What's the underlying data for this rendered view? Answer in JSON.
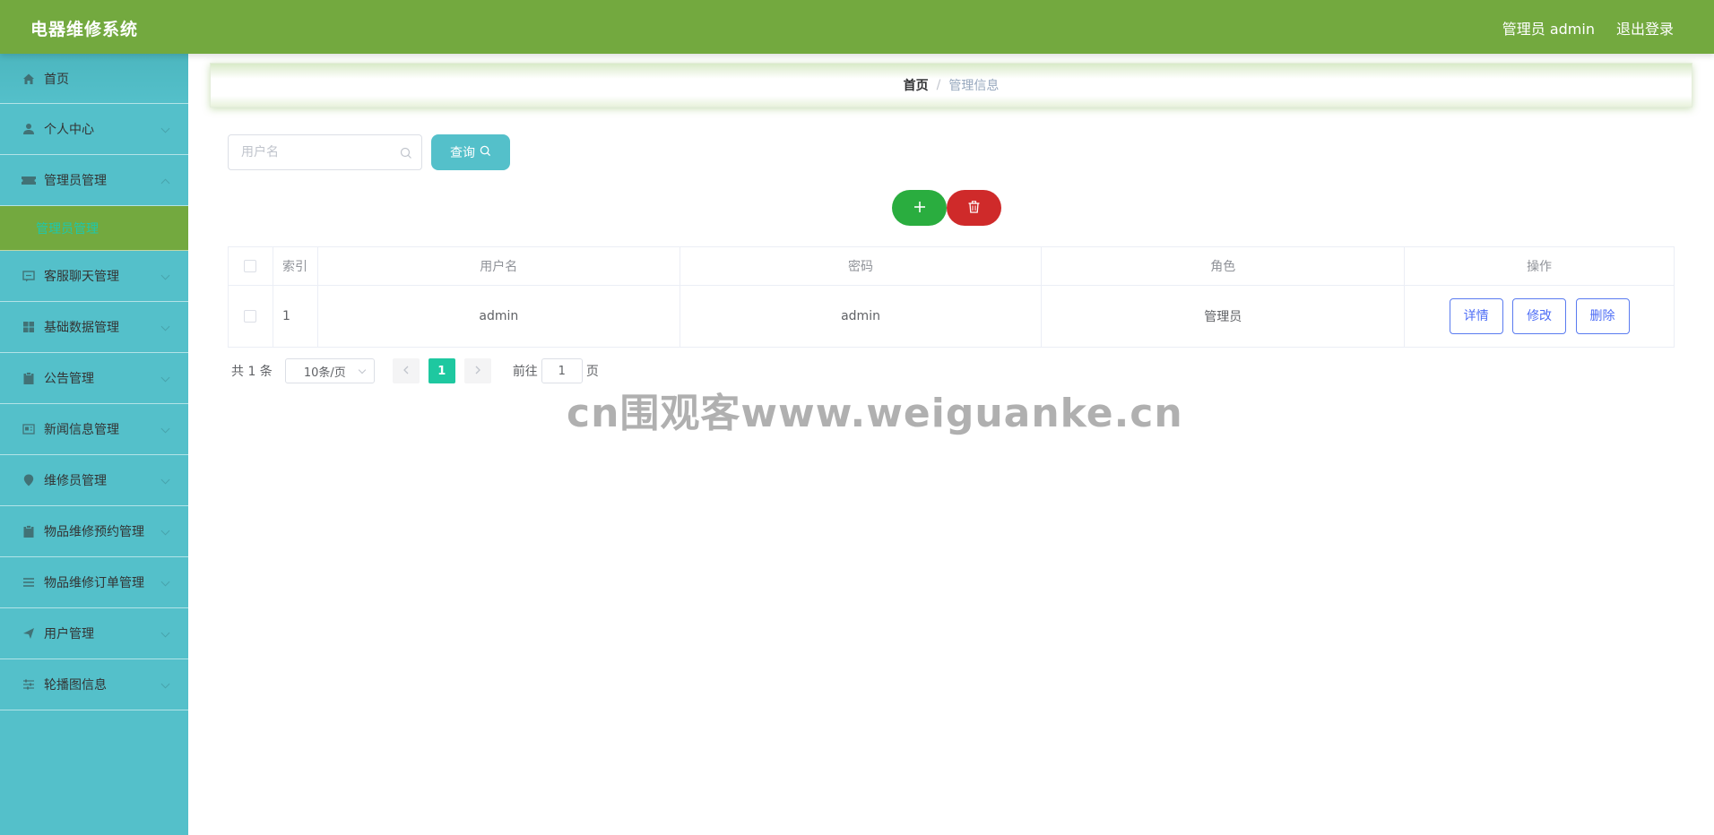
{
  "header": {
    "app_title": "电器维修系统",
    "user_label": "管理员 admin",
    "logout_label": "退出登录"
  },
  "sidebar": {
    "items": [
      {
        "label": "首页",
        "icon": "home-icon"
      },
      {
        "label": "个人中心",
        "icon": "user-icon"
      },
      {
        "label": "管理员管理",
        "icon": "ticket-icon",
        "open": true,
        "children": [
          {
            "label": "管理员管理"
          }
        ]
      },
      {
        "label": "客服聊天管理",
        "icon": "chat-icon"
      },
      {
        "label": "基础数据管理",
        "icon": "grid-icon"
      },
      {
        "label": "公告管理",
        "icon": "clipboard-icon"
      },
      {
        "label": "新闻信息管理",
        "icon": "news-icon"
      },
      {
        "label": "维修员管理",
        "icon": "location-icon"
      },
      {
        "label": "物品维修预约管理",
        "icon": "clipboard-icon"
      },
      {
        "label": "物品维修订单管理",
        "icon": "list-icon"
      },
      {
        "label": "用户管理",
        "icon": "send-icon"
      },
      {
        "label": "轮播图信息",
        "icon": "sliders-icon"
      }
    ]
  },
  "breadcrumb": {
    "home": "首页",
    "separator": "/",
    "current": "管理信息"
  },
  "search": {
    "placeholder": "用户名",
    "value": "",
    "button_label": "查询"
  },
  "table": {
    "headers": {
      "index": "索引",
      "username": "用户名",
      "password": "密码",
      "role": "角色",
      "actions": "操作"
    },
    "rows": [
      {
        "index": "1",
        "username": "admin",
        "password": "admin",
        "role": "管理员"
      }
    ],
    "actions": {
      "detail": "详情",
      "edit": "修改",
      "delete": "删除"
    }
  },
  "pagination": {
    "total_text": "共 1 条",
    "page_size": "10条/页",
    "current_page": "1",
    "goto_prefix": "前往",
    "goto_value": "1",
    "goto_suffix": "页"
  },
  "watermark": "cn围观客www.weiguanke.cn",
  "colors": {
    "header": "#73a93f",
    "sidebar": "#54c0ca",
    "submenu_active": "#73a93f",
    "add_button": "#2aad3f",
    "delete_button": "#cf2a2a",
    "action_button_border": "#5a7bf0",
    "current_page": "#1ec8a0"
  }
}
